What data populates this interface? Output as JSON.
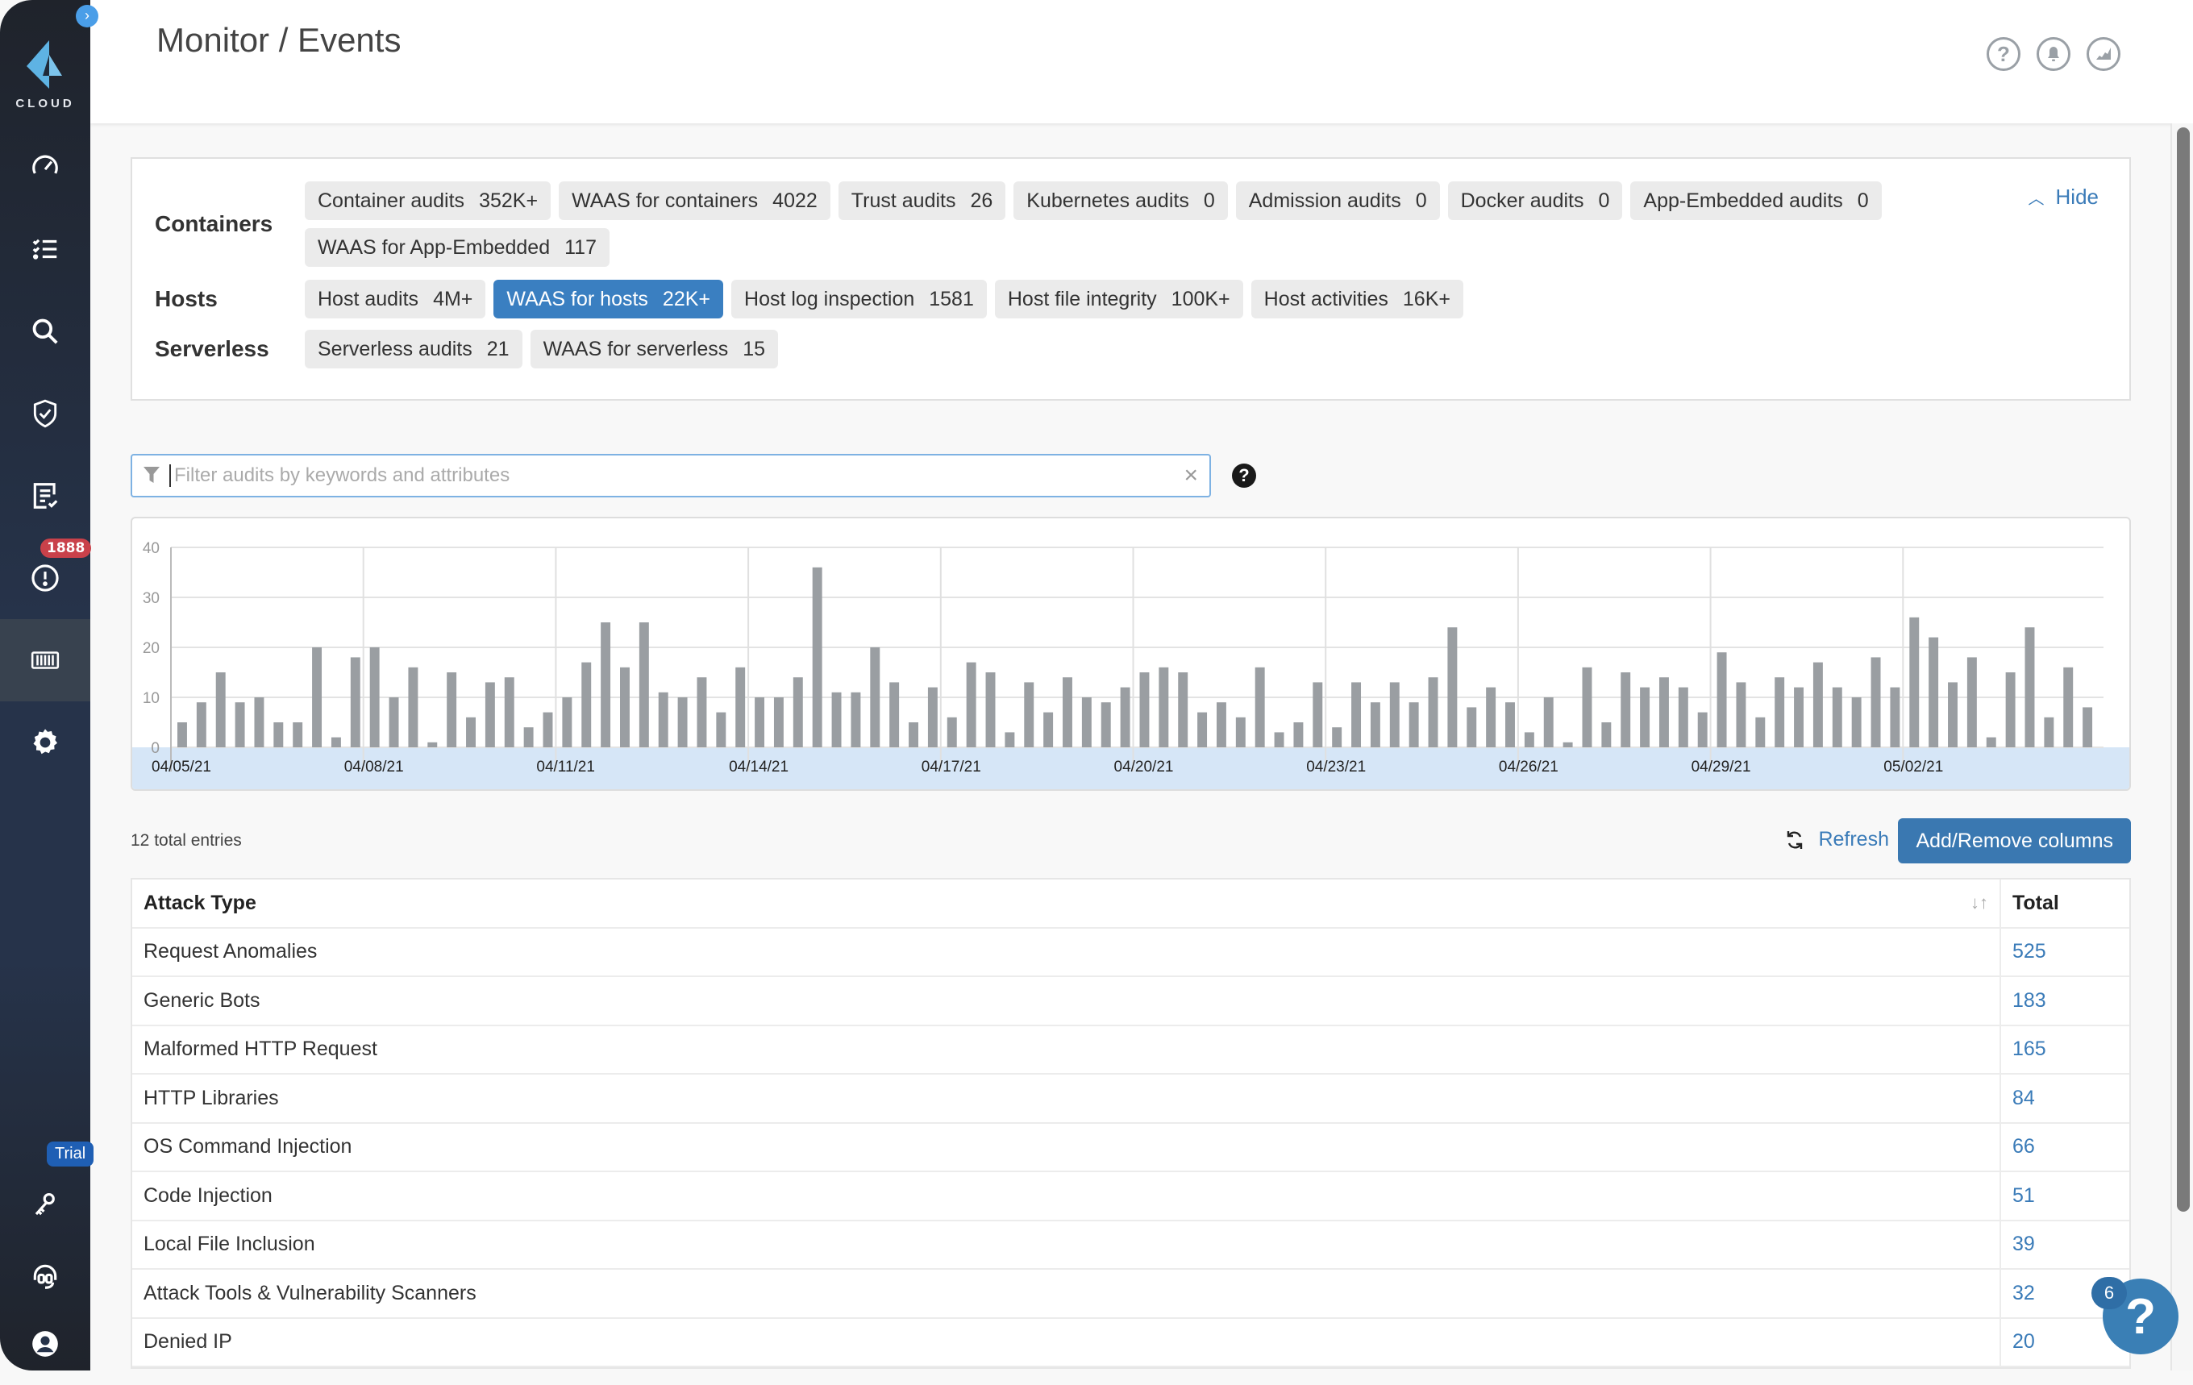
{
  "app": {
    "logo_text": "CLOUD",
    "collapse_icon": "chevron-right-icon"
  },
  "header": {
    "title": "Monitor / Events",
    "icons": [
      "help-icon",
      "bell-icon",
      "chart-icon"
    ]
  },
  "sidebar": {
    "items": [
      {
        "name": "dashboard",
        "icon": "speedometer-icon"
      },
      {
        "name": "checklist",
        "icon": "checklist-icon"
      },
      {
        "name": "search",
        "icon": "search-icon"
      },
      {
        "name": "defend",
        "icon": "shield-check-icon"
      },
      {
        "name": "compliance",
        "icon": "report-check-icon"
      },
      {
        "name": "alerts",
        "icon": "alert-circle-icon",
        "badge": "1888"
      },
      {
        "name": "monitor",
        "icon": "container-icon",
        "active": true
      },
      {
        "name": "settings",
        "icon": "gear-icon"
      }
    ],
    "bottom_items": [
      {
        "name": "license",
        "icon": "keys-icon",
        "badge": "Trial"
      },
      {
        "name": "support",
        "icon": "headset-icon"
      },
      {
        "name": "profile",
        "icon": "user-icon"
      }
    ]
  },
  "categories": {
    "hide_label": "Hide",
    "groups": [
      {
        "label": "Containers",
        "chips": [
          {
            "label": "Container audits",
            "count": "352K+"
          },
          {
            "label": "WAAS for containers",
            "count": "4022"
          },
          {
            "label": "Trust audits",
            "count": "26"
          },
          {
            "label": "Kubernetes audits",
            "count": "0"
          },
          {
            "label": "Admission audits",
            "count": "0"
          },
          {
            "label": "Docker audits",
            "count": "0"
          },
          {
            "label": "App-Embedded audits",
            "count": "0"
          },
          {
            "label": "WAAS for App-Embedded",
            "count": "117"
          }
        ]
      },
      {
        "label": "Hosts",
        "chips": [
          {
            "label": "Host audits",
            "count": "4M+"
          },
          {
            "label": "WAAS for hosts",
            "count": "22K+",
            "active": true
          },
          {
            "label": "Host log inspection",
            "count": "1581"
          },
          {
            "label": "Host file integrity",
            "count": "100K+"
          },
          {
            "label": "Host activities",
            "count": "16K+"
          }
        ]
      },
      {
        "label": "Serverless",
        "chips": [
          {
            "label": "Serverless audits",
            "count": "21"
          },
          {
            "label": "WAAS for serverless",
            "count": "15"
          }
        ]
      }
    ]
  },
  "filter": {
    "placeholder": "Filter audits by keywords and attributes",
    "value": ""
  },
  "chart_data": {
    "type": "bar",
    "title": "",
    "xlabel": "",
    "ylabel": "",
    "ylim": [
      0,
      40
    ],
    "yticks": [
      0,
      10,
      20,
      30,
      40
    ],
    "grid": true,
    "bar_color": "#9a9ea2",
    "xticks": [
      "04/05/21",
      "04/08/21",
      "04/11/21",
      "04/14/21",
      "04/17/21",
      "04/20/21",
      "04/23/21",
      "04/26/21",
      "04/29/21",
      "05/02/21"
    ],
    "bars_per_tick": 10,
    "values": [
      5,
      9,
      15,
      9,
      10,
      5,
      5,
      20,
      2,
      18,
      20,
      10,
      16,
      1,
      15,
      6,
      13,
      14,
      4,
      7,
      10,
      17,
      25,
      16,
      25,
      11,
      10,
      14,
      7,
      16,
      10,
      10,
      14,
      36,
      11,
      11,
      20,
      13,
      5,
      12,
      6,
      17,
      15,
      3,
      13,
      7,
      14,
      10,
      9,
      12,
      15,
      16,
      15,
      7,
      9,
      6,
      16,
      3,
      5,
      13,
      4,
      13,
      9,
      13,
      9,
      14,
      24,
      8,
      12,
      9,
      3,
      10,
      1,
      16,
      5,
      15,
      12,
      14,
      12,
      7,
      19,
      13,
      6,
      14,
      12,
      17,
      12,
      10,
      18,
      12,
      26,
      22,
      13,
      18,
      2,
      15,
      24,
      6,
      16,
      8
    ]
  },
  "toolbar": {
    "total_entries": "12 total entries",
    "refresh_label": "Refresh",
    "add_remove_columns_label": "Add/Remove columns"
  },
  "table": {
    "columns": [
      "Attack Type",
      "Total"
    ],
    "rows": [
      {
        "attack_type": "Request Anomalies",
        "total": "525"
      },
      {
        "attack_type": "Generic Bots",
        "total": "183"
      },
      {
        "attack_type": "Malformed HTTP Request",
        "total": "165"
      },
      {
        "attack_type": "HTTP Libraries",
        "total": "84"
      },
      {
        "attack_type": "OS Command Injection",
        "total": "66"
      },
      {
        "attack_type": "Code Injection",
        "total": "51"
      },
      {
        "attack_type": "Local File Inclusion",
        "total": "39"
      },
      {
        "attack_type": "Attack Tools & Vulnerability Scanners",
        "total": "32"
      },
      {
        "attack_type": "Denied IP",
        "total": "20"
      }
    ]
  },
  "help_fab": {
    "badge": "6",
    "icon": "question-icon"
  },
  "colors": {
    "accent": "#3a7bb8",
    "active_chip": "#3a7fc1",
    "sidebar_bg": "#26334a",
    "alert_badge": "#c9414a"
  }
}
